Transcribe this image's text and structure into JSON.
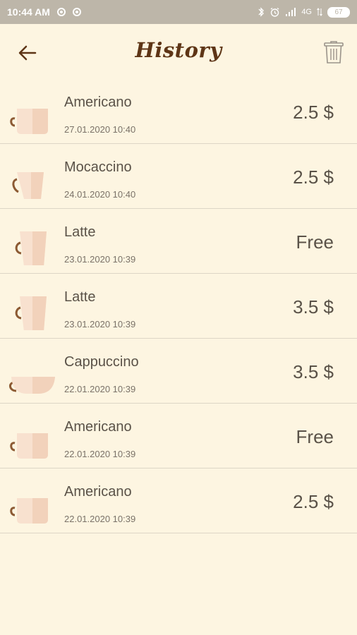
{
  "status_bar": {
    "time": "10:44 AM",
    "network": "4G",
    "battery": "67"
  },
  "header": {
    "title": "History"
  },
  "orders": [
    {
      "name": "Americano",
      "date": "27.01.2020 10:40",
      "price": "2.5 $",
      "cup": "mug"
    },
    {
      "name": "Mocaccino",
      "date": "24.01.2020 10:40",
      "price": "2.5 $",
      "cup": "cone"
    },
    {
      "name": "Latte",
      "date": "23.01.2020 10:39",
      "price": "Free",
      "cup": "tall"
    },
    {
      "name": "Latte",
      "date": "23.01.2020 10:39",
      "price": "3.5 $",
      "cup": "tall"
    },
    {
      "name": "Cappuccino",
      "date": "22.01.2020 10:39",
      "price": "3.5 $",
      "cup": "bowl"
    },
    {
      "name": "Americano",
      "date": "22.01.2020 10:39",
      "price": "Free",
      "cup": "mug"
    },
    {
      "name": "Americano",
      "date": "22.01.2020 10:39",
      "price": "2.5 $",
      "cup": "mug"
    }
  ],
  "colors": {
    "background": "#fdf5e1",
    "status_bar": "#bdb6a9",
    "title": "#5e3516",
    "cup_light": "#f8e1cf",
    "cup_dark": "#f2d2bb",
    "handle": "#8c5a33"
  }
}
